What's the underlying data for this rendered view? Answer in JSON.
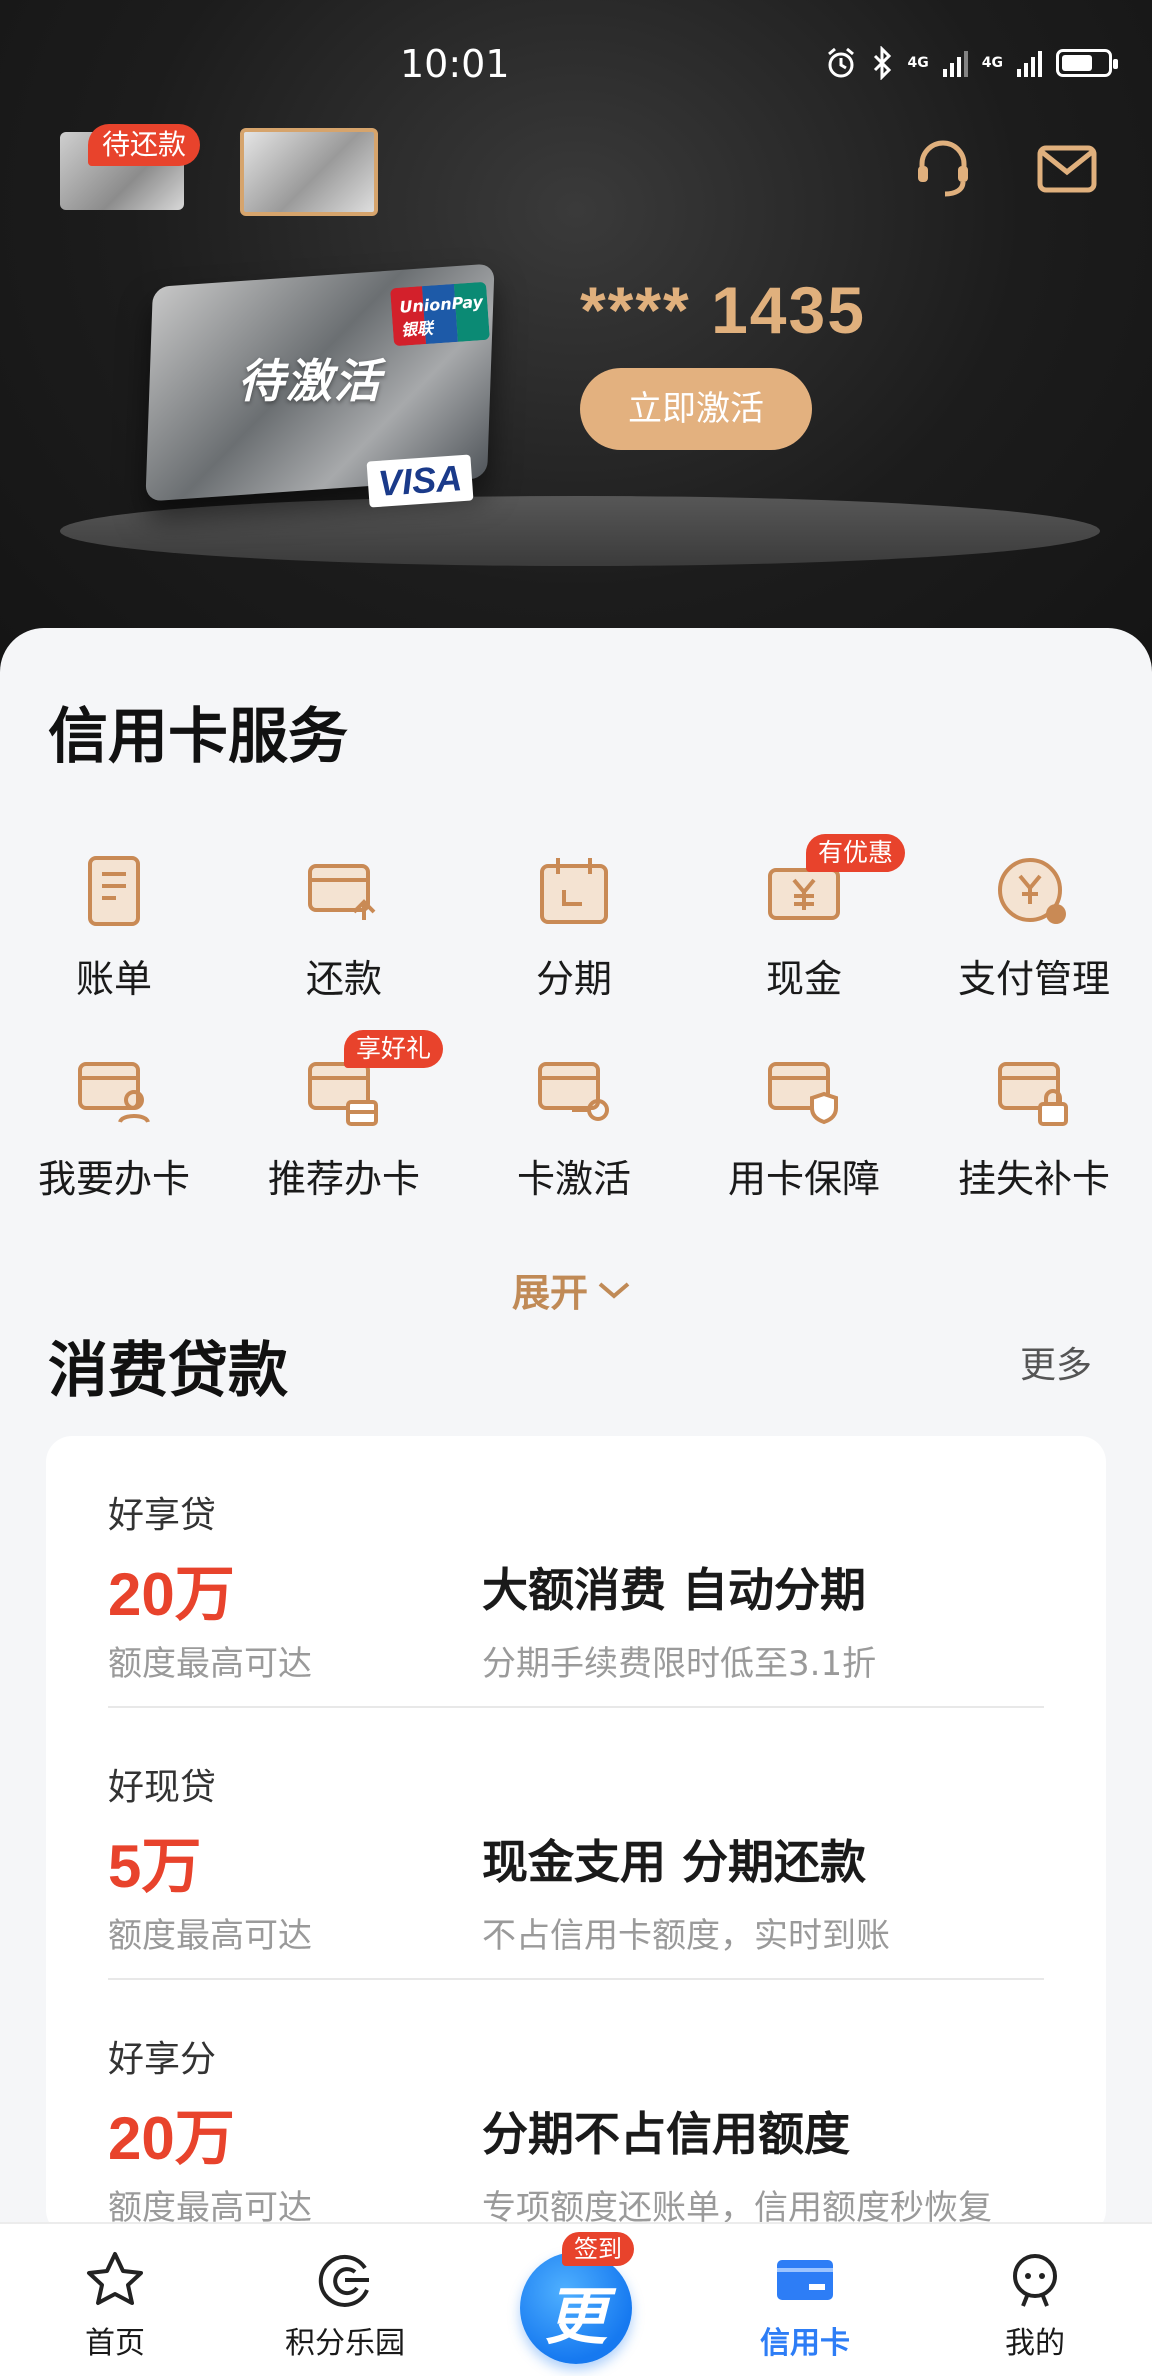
{
  "status_bar": {
    "time": "10:01",
    "net1": "4G",
    "net2": "4G"
  },
  "header": {
    "pending_badge": "待还款",
    "card_number": "**** 1435",
    "card_overlay": "待激活",
    "card_brand_visa": "VISA",
    "card_brand_unionpay": "UnionPay 银联",
    "activate_button": "立即激活"
  },
  "services": {
    "title": "信用卡服务",
    "items": [
      {
        "label": "账单"
      },
      {
        "label": "还款"
      },
      {
        "label": "分期"
      },
      {
        "label": "现金",
        "tag": "有优惠"
      },
      {
        "label": "支付管理"
      },
      {
        "label": "我要办卡"
      },
      {
        "label": "推荐办卡",
        "tag": "享好礼"
      },
      {
        "label": "卡激活"
      },
      {
        "label": "用卡保障"
      },
      {
        "label": "挂失补卡"
      }
    ],
    "expand_label": "展开"
  },
  "loans": {
    "title": "消费贷款",
    "more_label": "更多",
    "items": [
      {
        "name": "好享贷",
        "amount": "20万",
        "amount_note": "额度最高可达",
        "headline": "大额消费 自动分期",
        "sub": "分期手续费限时低至3.1折"
      },
      {
        "name": "好现贷",
        "amount": "5万",
        "amount_note": "额度最高可达",
        "headline": "现金支用 分期还款",
        "sub": "不占信用卡额度，实时到账"
      },
      {
        "name": "好享分",
        "amount": "20万",
        "amount_note": "额度最高可达",
        "headline": "分期不占信用额度",
        "sub": "专项额度还账单，信用额度秒恢复"
      }
    ]
  },
  "tabbar": {
    "tabs": [
      {
        "label": "首页"
      },
      {
        "label": "积分乐园"
      },
      {
        "label": ""
      },
      {
        "label": "信用卡"
      },
      {
        "label": "我的"
      }
    ],
    "center_badge": "签到",
    "center_glyph": "更",
    "active_color": "#2d7df6"
  },
  "colors": {
    "accent_gold": "#c08a56",
    "brand_red": "#e8432c",
    "blue": "#2d7df6"
  }
}
